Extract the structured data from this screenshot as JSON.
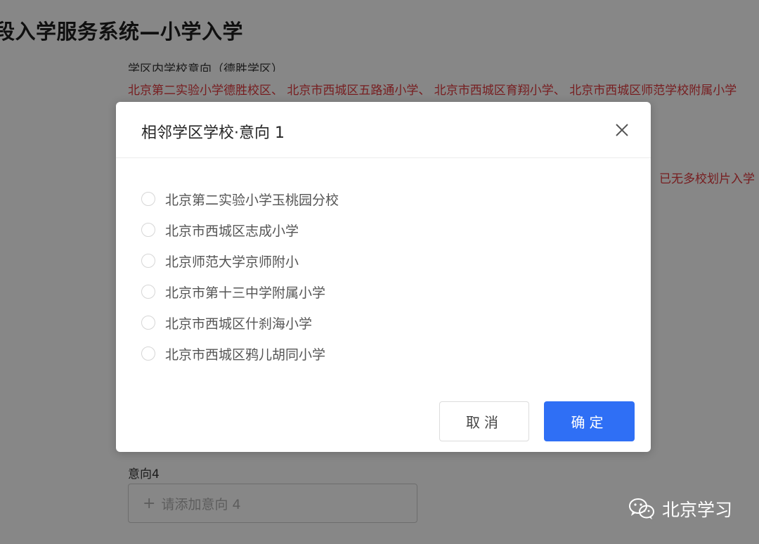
{
  "page": {
    "title": "段入学服务系统—小学入学",
    "district_label": "学区内学校意向（德胜学区）",
    "district_schools": "北京第二实验小学德胜校区、 北京市西城区五路通小学、 北京市西城区育翔小学、 北京市西城区师范学校附属小学",
    "right_note": "已无多校划片入学",
    "intent4": {
      "label": "意向4",
      "placeholder": "请添加意向 4",
      "plus": "+"
    }
  },
  "modal": {
    "title": "相邻学区学校·意向 1",
    "close_icon": "close-icon",
    "options": [
      {
        "label": "北京第二实验小学玉桃园分校",
        "selected": false
      },
      {
        "label": "北京市西城区志成小学",
        "selected": false
      },
      {
        "label": "北京师范大学京师附小",
        "selected": false
      },
      {
        "label": "北京市第十三中学附属小学",
        "selected": false
      },
      {
        "label": "北京市西城区什刹海小学",
        "selected": false
      },
      {
        "label": "北京市西城区鸦儿胡同小学",
        "selected": false
      }
    ],
    "cancel_label": "取消",
    "ok_label": "确定"
  },
  "watermark": {
    "text": "北京学习",
    "icon": "wechat-icon"
  },
  "colors": {
    "primary": "#2f6ff5",
    "alert_text": "#e0393e",
    "overlay": "rgba(0,0,0,0.47)"
  }
}
